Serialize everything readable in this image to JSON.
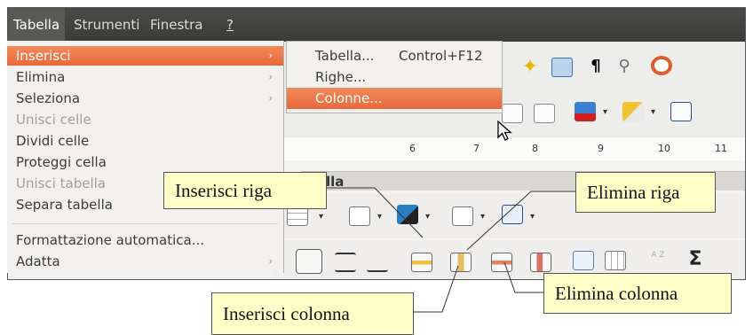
{
  "menubar": {
    "items": [
      {
        "label": "Tabella"
      },
      {
        "label": "Strumenti"
      },
      {
        "label": "Finestra"
      },
      {
        "label": "?"
      }
    ]
  },
  "menu": {
    "items": [
      {
        "label": "Inserisci",
        "has_submenu": true,
        "state": "highlighted"
      },
      {
        "label": "Elimina",
        "has_submenu": true
      },
      {
        "label": "Seleziona",
        "has_submenu": true
      },
      {
        "label": "Unisci celle",
        "state": "disabled"
      },
      {
        "label": "Dividi celle"
      },
      {
        "label": "Proteggi cella"
      },
      {
        "label": "Unisci tabella",
        "state": "disabled"
      },
      {
        "label": "Separa tabella"
      },
      {
        "label": "Formattazione automatica..."
      },
      {
        "label": "Adatta",
        "has_submenu": true
      }
    ]
  },
  "submenu": {
    "items": [
      {
        "label": "Tabella...",
        "accelerator": "Control+F12"
      },
      {
        "label": "Righe..."
      },
      {
        "label": "Colonne...",
        "state": "highlighted"
      }
    ]
  },
  "document": {
    "table_toolbar_title": "lla",
    "ruler_numbers": [
      "6",
      "7",
      "8",
      "9",
      "10",
      "11"
    ]
  },
  "callouts": {
    "inserisci_riga": "Inserisci riga",
    "elimina_riga": "Elimina riga",
    "elimina_colonna": "Elimina colonna",
    "inserisci_colonna": "Inserisci colonna"
  },
  "colors": {
    "highlight": "#e9693b",
    "menubar": "#3b3b38",
    "callout_bg": "#ffffc8"
  }
}
